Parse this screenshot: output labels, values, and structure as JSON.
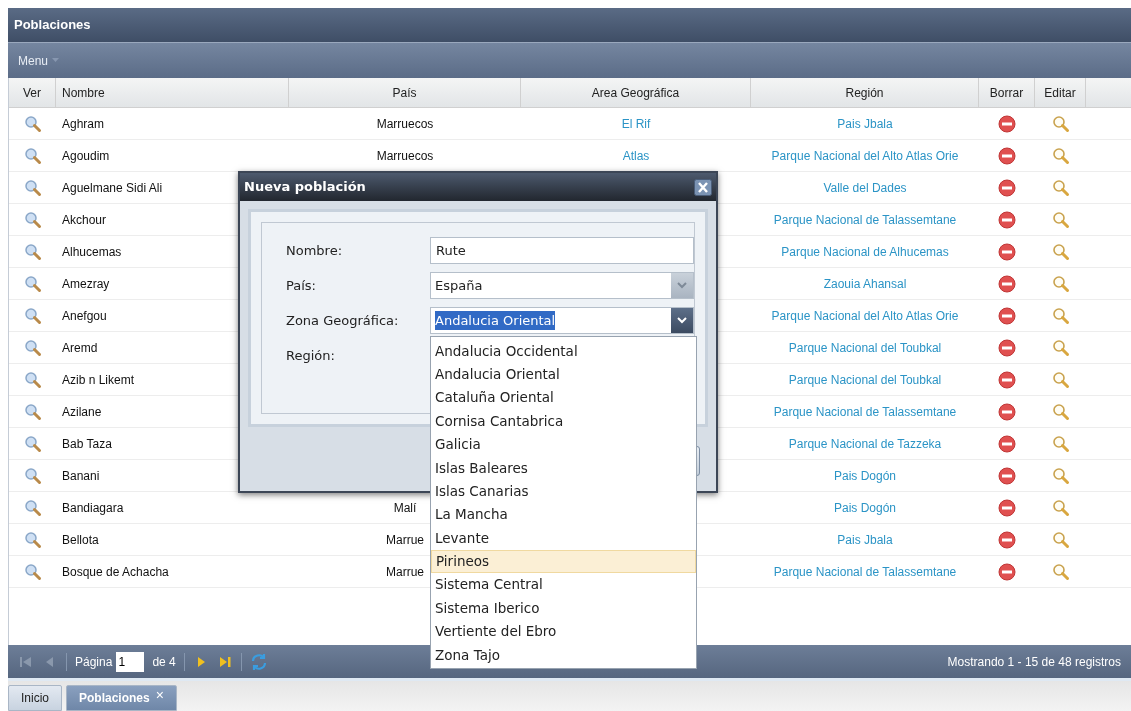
{
  "panel": {
    "title": "Poblaciones"
  },
  "menu": {
    "label": "Menu"
  },
  "columns": [
    "Ver",
    "Nombre",
    "País",
    "Area Geográfica",
    "Región",
    "Borrar",
    "Editar"
  ],
  "rows": [
    {
      "nombre": "Aghram",
      "pais": "Marruecos",
      "area": "El Rif",
      "region": "Pais Jbala"
    },
    {
      "nombre": "Agoudim",
      "pais": "Marruecos",
      "area": "Atlas",
      "region": "Parque Nacional del Alto Atlas Orie"
    },
    {
      "nombre": "Aguelmane Sidi Ali",
      "region": "Valle del Dades"
    },
    {
      "nombre": "Akchour",
      "region": "Parque Nacional de Talassemtane"
    },
    {
      "nombre": "Alhucemas",
      "region": "Parque Nacional de Alhucemas"
    },
    {
      "nombre": "Amezray",
      "region": "Zaouia Ahansal"
    },
    {
      "nombre": "Anefgou",
      "region": "Parque Nacional del Alto Atlas Orie"
    },
    {
      "nombre": "Aremd",
      "region": "Parque Nacional del Toubkal"
    },
    {
      "nombre": "Azib n Likemt",
      "region": "Parque Nacional del Toubkal"
    },
    {
      "nombre": "Azilane",
      "region": "Parque Nacional de Talassemtane"
    },
    {
      "nombre": "Bab Taza",
      "region": "Parque Nacional de Tazzeka"
    },
    {
      "nombre": "Banani",
      "region": "Pais Dogón"
    },
    {
      "nombre": "Bandiagara",
      "pais": "Malí",
      "region": "Pais Dogón"
    },
    {
      "nombre": "Bellota",
      "pais": "Marrue",
      "region": "Pais Jbala"
    },
    {
      "nombre": "Bosque de Achacha",
      "pais": "Marrue",
      "region": "Parque Nacional de Talassemtane"
    }
  ],
  "dialog": {
    "title": "Nueva población",
    "fields": [
      {
        "kind": "text",
        "label": "Nombre:",
        "value": "Rute"
      },
      {
        "kind": "combo",
        "label": "País:",
        "value": "España",
        "expanded": false
      },
      {
        "kind": "combo",
        "label": "Zona Geográfica:",
        "value": "Andalucia Oriental",
        "expanded": true,
        "text_selected": true,
        "options": [
          {
            "label": "Andalucia Occidental",
            "highlighted": false
          },
          {
            "label": "Andalucia Oriental",
            "highlighted": false
          },
          {
            "label": "Cataluña Oriental",
            "highlighted": false
          },
          {
            "label": "Cornisa Cantabrica",
            "highlighted": false
          },
          {
            "label": "Galicia",
            "highlighted": false
          },
          {
            "label": "Islas Baleares",
            "highlighted": false
          },
          {
            "label": "Islas Canarias",
            "highlighted": false
          },
          {
            "label": "La Mancha",
            "highlighted": false
          },
          {
            "label": "Levante",
            "highlighted": false
          },
          {
            "label": "Pirineos",
            "highlighted": true
          },
          {
            "label": "Sistema Central",
            "highlighted": false
          },
          {
            "label": "Sistema Iberico",
            "highlighted": false
          },
          {
            "label": "Vertiente del Ebro",
            "highlighted": false
          },
          {
            "label": "Zona Tajo",
            "highlighted": false
          }
        ]
      },
      {
        "kind": "covered",
        "label": "Región:"
      }
    ]
  },
  "paging": {
    "back": [
      {
        "kind": "first",
        "disabled": true
      },
      {
        "kind": "prev",
        "disabled": true
      }
    ],
    "page_label": "Página",
    "page": "1",
    "page_count": "de 4",
    "forward": [
      {
        "kind": "next",
        "disabled": false
      },
      {
        "kind": "last",
        "disabled": false
      }
    ],
    "status": "Mostrando 1 - 15 de 48 registros"
  },
  "tabs": [
    {
      "label": "Inicio",
      "selected": false,
      "closable": false
    },
    {
      "label": "Poblaciones",
      "selected": true,
      "closable": true,
      "close": "×"
    }
  ]
}
